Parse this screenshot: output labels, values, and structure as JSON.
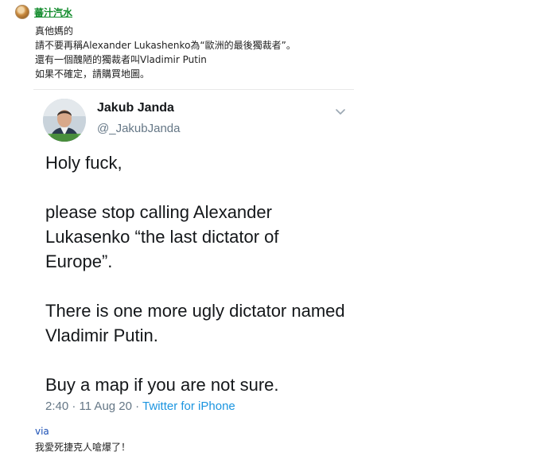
{
  "post": {
    "author": "蕃汁汽水",
    "lines": [
      "真他媽的",
      "請不要再稱Alexander Lukashenko為“歐洲的最後獨裁者”。",
      "還有一個醜陋的獨裁者叫Vladimir Putin",
      "如果不確定，請購買地圖。"
    ]
  },
  "tweet": {
    "name": "Jakub Janda",
    "handle": "@_JakubJanda",
    "paragraphs": [
      "Holy fuck,",
      "please stop calling Alexander Lukasenko “the last dictator of Europe”.",
      "There is one more ugly dictator named Vladimir Putin.",
      "Buy a map if you are not sure."
    ],
    "meta_time": "2:40 · 11 Aug 20 · ",
    "meta_source": "Twitter for iPhone"
  },
  "footer": {
    "via": "via",
    "comment": "我愛死捷克人嗆爆了！"
  },
  "colors": {
    "author_link": "#0f8a2a",
    "via_link": "#1a4fb5",
    "tweet_source": "#1b95e0",
    "tweet_secondary": "#657786"
  },
  "icons": {
    "poster_avatar": "avatar-icon",
    "tweet_menu": "chevron-down-icon"
  }
}
